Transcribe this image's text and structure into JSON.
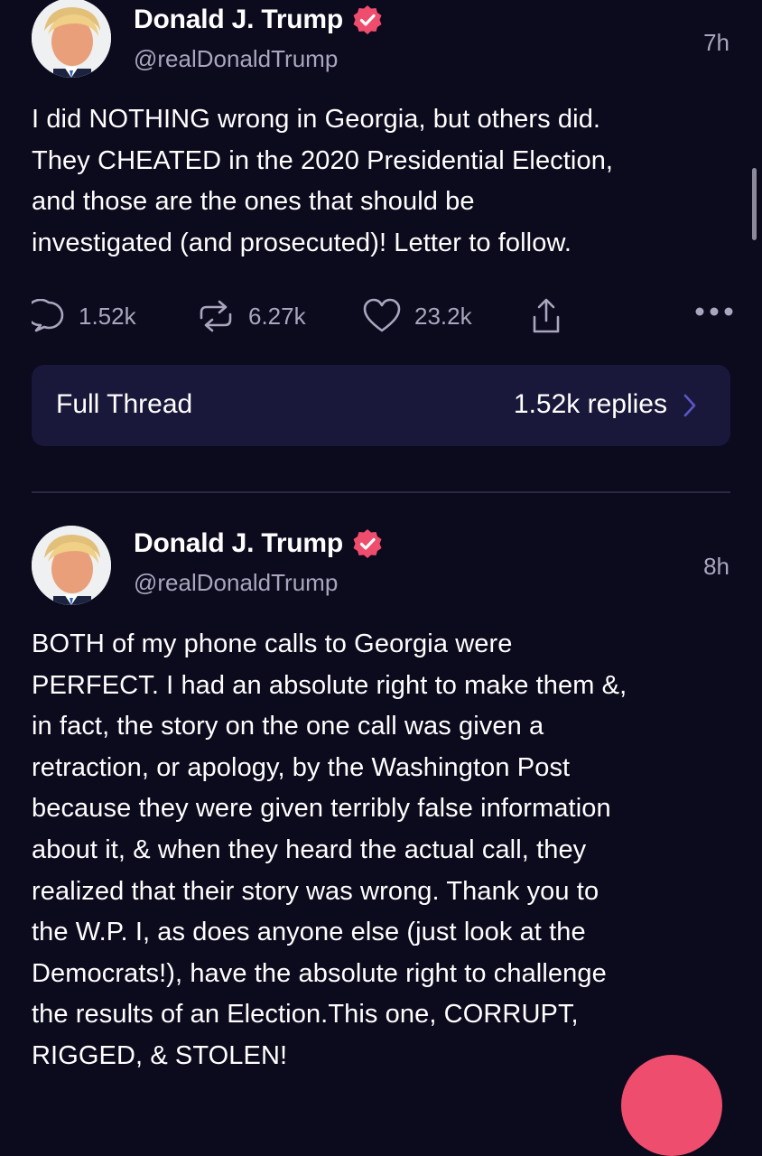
{
  "colors": {
    "background": "#0c0a1d",
    "accent": "#ef4d6d",
    "secondary_text": "#a9a6bd",
    "card": "#19183a"
  },
  "posts": [
    {
      "author": "Donald J. Trump",
      "handle": "@realDonaldTrump",
      "time": "7h",
      "verified_icon": "verified-badge-icon",
      "text": "I did NOTHING wrong in Georgia, but others did.\nThey CHEATED in the 2020 Presidential Election,\nand those are the ones that should be\ninvestigated (and prosecuted)! Letter to follow.",
      "actions": {
        "replies": "1.52k",
        "reposts": "6.27k",
        "likes": "23.2k"
      },
      "icons": [
        "reply-icon",
        "repost-icon",
        "heart-icon",
        "share-icon",
        "more-icon"
      ]
    },
    {
      "author": "Donald J. Trump",
      "handle": "@realDonaldTrump",
      "time": "8h",
      "verified_icon": "verified-badge-icon",
      "text": "BOTH of my phone calls to Georgia were\nPERFECT. I had an absolute right to make them &,\nin fact, the story on the one call was given a\nretraction, or apology, by the Washington Post\nbecause they were given terribly false information\nabout it, & when they heard the actual call, they\nrealized that their story was wrong. Thank you to\nthe W.P. I, as does anyone else (just look at the\nDemocrats!), have the absolute right to challenge\nthe results of an Election.This one, CORRUPT,\nRIGGED, & STOLEN!"
    }
  ],
  "thread": {
    "label": "Full Thread",
    "replies": "1.52k replies",
    "icon": "chevron-right-icon"
  }
}
